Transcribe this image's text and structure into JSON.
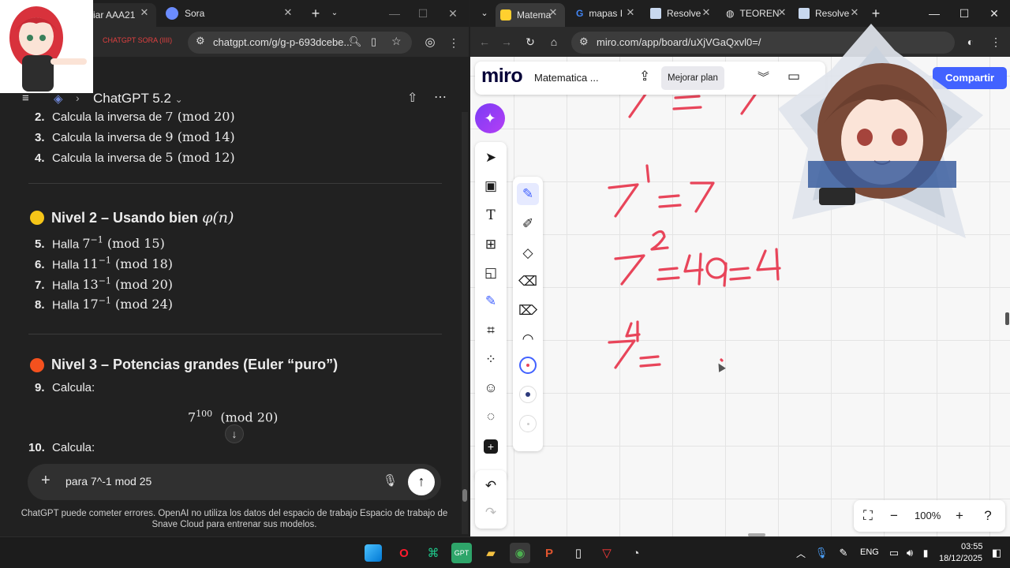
{
  "left_window": {
    "tabs": [
      {
        "label": "iar AAA21",
        "active": true
      },
      {
        "label": "Sora",
        "active": false
      }
    ],
    "bookmark_red": "CHATGPT SORA (IIII)",
    "url": "chatgpt.com/g/g-p-693dcebe...",
    "chat_title": "ChatGPT 5.2",
    "items_top": [
      {
        "num": "2.",
        "text": "Calcula la inversa de",
        "math": "7 (mod 20)"
      },
      {
        "num": "3.",
        "text": "Calcula la inversa de",
        "math": "9 (mod 14)"
      },
      {
        "num": "4.",
        "text": "Calcula la inversa de",
        "math": "5 (mod 12)"
      }
    ],
    "level2_title": "Nivel 2 – Usando bien",
    "level2_math": "φ(n)",
    "level2_items": [
      {
        "num": "5.",
        "text": "Halla",
        "base": "7",
        "exp": "−1",
        "mod": "(mod 15)"
      },
      {
        "num": "6.",
        "text": "Halla",
        "base": "11",
        "exp": "−1",
        "mod": "(mod 18)"
      },
      {
        "num": "7.",
        "text": "Halla",
        "base": "13",
        "exp": "−1",
        "mod": "(mod 20)"
      },
      {
        "num": "8.",
        "text": "Halla",
        "base": "17",
        "exp": "−1",
        "mod": "(mod 24)"
      }
    ],
    "level3_title": "Nivel 3 – Potencias grandes (Euler “puro”)",
    "level3_items": [
      {
        "num": "9.",
        "text": "Calcula:"
      },
      {
        "num": "10.",
        "text": "Calcula:"
      }
    ],
    "display_math": {
      "base": "7",
      "exp": "100",
      "mod": "(mod 20)"
    },
    "input_value": "para 7^-1 mod 25",
    "disclaimer": "ChatGPT puede cometer errores. OpenAI no utiliza los datos del espacio de trabajo Espacio de trabajo de Snave Cloud para entrenar sus modelos.",
    "colors": {
      "level2_dot": "#f5c518",
      "level3_dot": "#f4511e"
    }
  },
  "right_window": {
    "tabs": [
      {
        "label": "Matema",
        "active": true
      },
      {
        "label": "mapas I",
        "active": false
      },
      {
        "label": "Resolve",
        "active": false
      },
      {
        "label": "TEOREN",
        "active": false
      },
      {
        "label": "Resolve",
        "active": false
      }
    ],
    "url": "miro.com/app/board/uXjVGaQxvl0=/",
    "board": {
      "logo": "miro",
      "board_name": "Matematica ...",
      "upgrade_label": "Mejorar plan",
      "share_label": "Compartir",
      "zoom": "100%"
    },
    "handwriting": [
      "7¹ = 7",
      "7² = 49 = 4",
      "7⁴ ="
    ],
    "ink_color": "#e8455a"
  },
  "taskbar": {
    "lang": "ENG",
    "time": "03:55",
    "date": "18/12/2025"
  }
}
